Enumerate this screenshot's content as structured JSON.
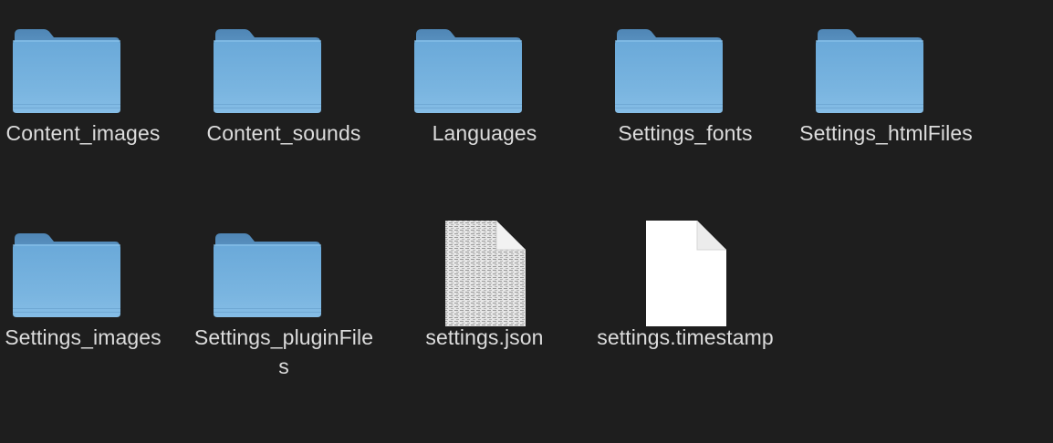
{
  "window": {
    "view": "icon-grid",
    "background": "#1e1e1e"
  },
  "colors": {
    "folder_tab": "#5d95c4",
    "folder_body_top": "#6aa9d9",
    "folder_body_bottom": "#85bde6",
    "label_text": "#dcdcdc",
    "document_fill": "#ffffff"
  },
  "items": [
    {
      "name": "Content_images",
      "kind": "folder",
      "icon": "folder-icon"
    },
    {
      "name": "Content_sounds",
      "kind": "folder",
      "icon": "folder-icon"
    },
    {
      "name": "Languages",
      "kind": "folder",
      "icon": "folder-icon"
    },
    {
      "name": "Settings_fonts",
      "kind": "folder",
      "icon": "folder-icon"
    },
    {
      "name": "Settings_htmlFiles",
      "kind": "folder",
      "icon": "folder-icon"
    },
    {
      "name": "Settings_images",
      "kind": "folder",
      "icon": "folder-icon"
    },
    {
      "name": "Settings_pluginFiles",
      "kind": "folder",
      "icon": "folder-icon"
    },
    {
      "name": "settings.json",
      "kind": "document",
      "icon": "json-document-icon"
    },
    {
      "name": "settings.timestamp",
      "kind": "document",
      "icon": "blank-document-icon"
    }
  ]
}
